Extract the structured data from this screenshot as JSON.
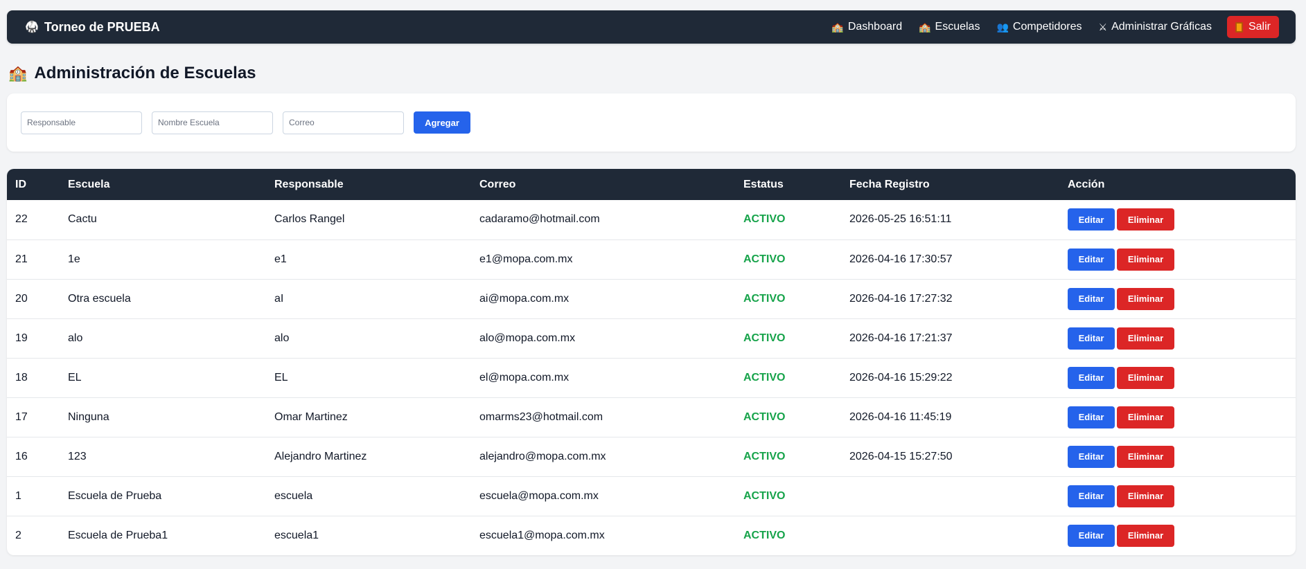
{
  "brand": {
    "icon": "🥋",
    "title": "Torneo de PRUEBA"
  },
  "nav": {
    "links": [
      {
        "icon": "🏫",
        "label": "Dashboard"
      },
      {
        "icon": "🏫",
        "label": "Escuelas"
      },
      {
        "icon": "👥",
        "label": "Competidores"
      },
      {
        "icon": "⚔",
        "label": "Administrar Gráficas"
      }
    ],
    "exit_label": "Salir"
  },
  "page": {
    "icon": "🏫",
    "title": "Administración de Escuelas"
  },
  "form": {
    "responsable_placeholder": "Responsable",
    "escuela_placeholder": "Nombre Escuela",
    "correo_placeholder": "Correo",
    "add_label": "Agregar"
  },
  "table": {
    "headers": [
      "ID",
      "Escuela",
      "Responsable",
      "Correo",
      "Estatus",
      "Fecha Registro",
      "Acción"
    ],
    "edit_label": "Editar",
    "delete_label": "Eliminar",
    "rows": [
      {
        "id": "22",
        "escuela": "Cactu",
        "responsable": "Carlos Rangel",
        "correo": "cadaramo@hotmail.com",
        "estatus": "ACTIVO",
        "fecha": "2026-05-25 16:51:11"
      },
      {
        "id": "21",
        "escuela": "1e",
        "responsable": "e1",
        "correo": "e1@mopa.com.mx",
        "estatus": "ACTIVO",
        "fecha": "2026-04-16 17:30:57"
      },
      {
        "id": "20",
        "escuela": "Otra escuela",
        "responsable": "aI",
        "correo": "ai@mopa.com.mx",
        "estatus": "ACTIVO",
        "fecha": "2026-04-16 17:27:32"
      },
      {
        "id": "19",
        "escuela": "alo",
        "responsable": "alo",
        "correo": "alo@mopa.com.mx",
        "estatus": "ACTIVO",
        "fecha": "2026-04-16 17:21:37"
      },
      {
        "id": "18",
        "escuela": "EL",
        "responsable": "EL",
        "correo": "el@mopa.com.mx",
        "estatus": "ACTIVO",
        "fecha": "2026-04-16 15:29:22"
      },
      {
        "id": "17",
        "escuela": "Ninguna",
        "responsable": "Omar Martinez",
        "correo": "omarms23@hotmail.com",
        "estatus": "ACTIVO",
        "fecha": "2026-04-16 11:45:19"
      },
      {
        "id": "16",
        "escuela": "123",
        "responsable": "Alejandro Martinez",
        "correo": "alejandro@mopa.com.mx",
        "estatus": "ACTIVO",
        "fecha": "2026-04-15 15:27:50"
      },
      {
        "id": "1",
        "escuela": "Escuela de Prueba",
        "responsable": "escuela",
        "correo": "escuela@mopa.com.mx",
        "estatus": "ACTIVO",
        "fecha": ""
      },
      {
        "id": "2",
        "escuela": "Escuela de Prueba1",
        "responsable": "escuela1",
        "correo": "escuela1@mopa.com.mx",
        "estatus": "ACTIVO",
        "fecha": ""
      }
    ]
  }
}
